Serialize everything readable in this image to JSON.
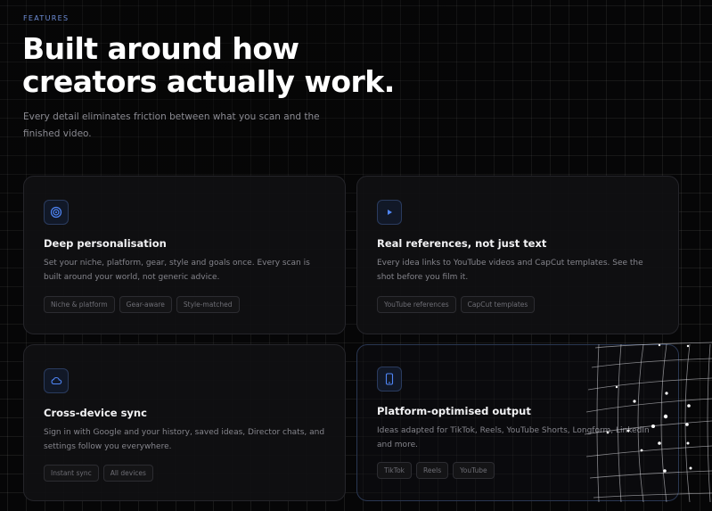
{
  "header": {
    "eyebrow": "FEATURES",
    "title_line1": "Built around how",
    "title_line2": "creators actually work.",
    "subtitle": "Every detail eliminates friction between what you scan and the finished video."
  },
  "cards": [
    {
      "icon": "target-icon",
      "title": "Deep personalisation",
      "description": "Set your niche, platform, gear, style and goals once. Every scan is built around your world, not generic advice.",
      "tags": [
        "Niche & platform",
        "Gear-aware",
        "Style-matched"
      ]
    },
    {
      "icon": "play-icon",
      "title": "Real references, not just text",
      "description": "Every idea links to YouTube videos and CapCut templates. See the shot before you film it.",
      "tags": [
        "YouTube references",
        "CapCut templates"
      ]
    },
    {
      "icon": "cloud-icon",
      "title": "Cross-device sync",
      "description": "Sign in with Google and your history, saved ideas, Director chats, and settings follow you everywhere.",
      "tags": [
        "Instant sync",
        "All devices"
      ]
    },
    {
      "icon": "phone-icon",
      "title": "Platform-optimised output",
      "description": "Ideas adapted for TikTok, Reels, YouTube Shorts, Longform, LinkedIn and more.",
      "tags": [
        "TikTok",
        "Reels",
        "YouTube"
      ]
    }
  ],
  "colors": {
    "accent": "#6f8fd9",
    "icon_blue": "#4f86f7",
    "background": "#060607"
  }
}
